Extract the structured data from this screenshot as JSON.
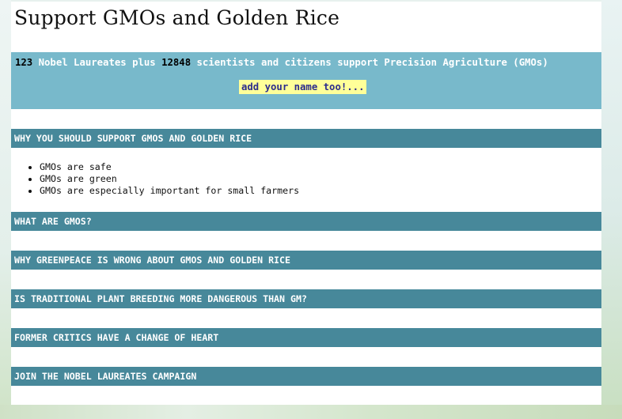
{
  "page": {
    "title": "Support GMOs and Golden Rice"
  },
  "banner": {
    "laureates_count": "123",
    "laureates_text": " Nobel Laureates plus ",
    "scientists_count": "12848",
    "scientists_text": " scientists and citizens support Precision Agriculture (GMOs)",
    "cta_label": "add your name too!..."
  },
  "sections": [
    {
      "heading": "WHY YOU SHOULD SUPPORT GMOS AND GOLDEN RICE"
    },
    {
      "heading": "WHAT ARE GMOS?"
    },
    {
      "heading": "WHY GREENPEACE IS WRONG ABOUT GMOS AND GOLDEN RICE"
    },
    {
      "heading": "IS TRADITIONAL PLANT BREEDING MORE DANGEROUS THAN GM?"
    },
    {
      "heading": "FORMER CRITICS HAVE A CHANGE OF HEART"
    },
    {
      "heading": "JOIN THE NOBEL LAUREATES CAMPAIGN"
    }
  ],
  "why_support_items": [
    "GMOs are safe",
    "GMOs are green",
    "GMOs are especially important for small farmers"
  ],
  "colors": {
    "banner": "#78b9cb",
    "section_header": "#47889a",
    "cta_highlight": "#ffff99"
  }
}
